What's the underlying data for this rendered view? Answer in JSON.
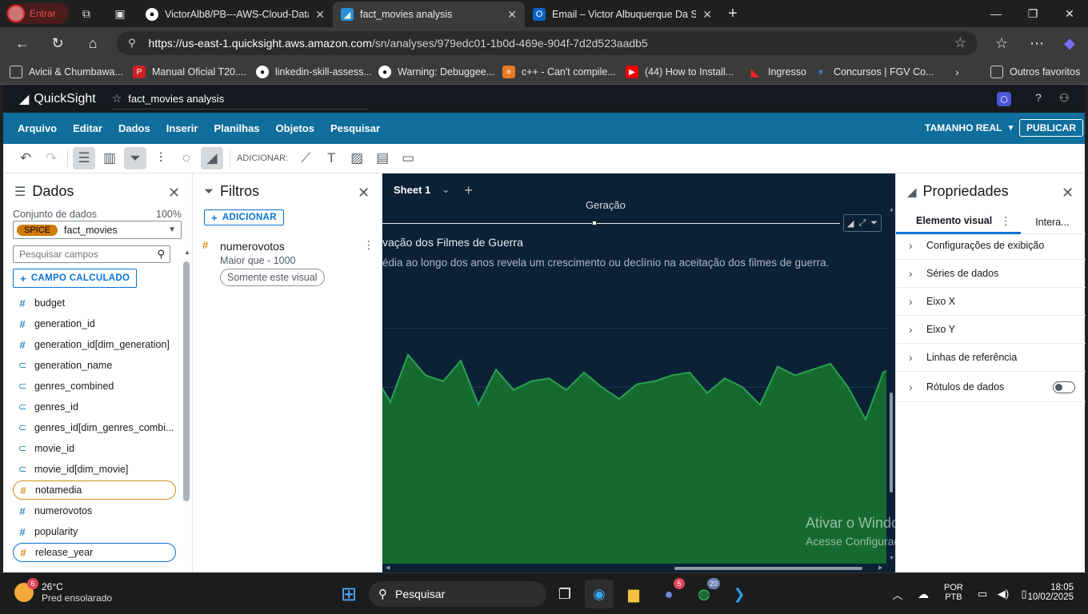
{
  "browser": {
    "profile_label": "Entrar",
    "tabs": [
      {
        "title": "VictorAlb8/PB---AWS-Cloud-Data",
        "icon": "github-icon"
      },
      {
        "title": "fact_movies analysis",
        "icon": "quicksight-icon",
        "active": true
      },
      {
        "title": "Email – Victor Albuquerque Da Si",
        "icon": "outlook-icon"
      }
    ],
    "url_host": "https://us-east-1.quicksight.aws.amazon.com",
    "url_path": "/sn/analyses/979edc01-1b0d-469e-904f-7d2d523aadb5",
    "bookmarks": [
      "Avicii & Chumbawa...",
      "Manual Oficial T20....",
      "linkedin-skill-assess...",
      "Warning: Debuggee...",
      "c++ - Can't compile...",
      "(44) How to Install...",
      "Ingresso",
      "Concursos | FGV Co..."
    ],
    "other_favorites": "Outros favoritos"
  },
  "quicksight": {
    "brand": "QuickSight",
    "analysis_name": "fact_movies analysis",
    "menu": [
      "Arquivo",
      "Editar",
      "Dados",
      "Inserir",
      "Planilhas",
      "Objetos",
      "Pesquisar"
    ],
    "view_size": "TAMANHO REAL",
    "publish": "PUBLICAR",
    "add_label": "ADICIONAR:",
    "colors": {
      "header": "#16191f",
      "menu": "#0f6e9c",
      "canvas": "#0b2136",
      "area": "#166a2f",
      "line": "#2aa152"
    }
  },
  "dados": {
    "title": "Dados",
    "dataset_label": "Conjunto de dados",
    "dataset_pct": "100%",
    "spice": "SPICE",
    "dataset": "fact_movies",
    "search_placeholder": "Pesquisar campos",
    "calc_field": "CAMPO CALCULADO",
    "fields": [
      {
        "name": "budget",
        "type": "num"
      },
      {
        "name": "generation_id",
        "type": "num"
      },
      {
        "name": "generation_id[dim_generation]",
        "type": "num"
      },
      {
        "name": "generation_name",
        "type": "dim"
      },
      {
        "name": "genres_combined",
        "type": "dim"
      },
      {
        "name": "genres_id",
        "type": "dim"
      },
      {
        "name": "genres_id[dim_genres_combi...",
        "type": "dim"
      },
      {
        "name": "movie_id",
        "type": "dim"
      },
      {
        "name": "movie_id[dim_movie]",
        "type": "dim"
      },
      {
        "name": "notamedia",
        "type": "num",
        "selected": "orange"
      },
      {
        "name": "numerovotos",
        "type": "num"
      },
      {
        "name": "popularity",
        "type": "num"
      },
      {
        "name": "release_year",
        "type": "num",
        "selected": "blue"
      }
    ]
  },
  "filtros": {
    "title": "Filtros",
    "add": "ADICIONAR",
    "filter_field": "numerovotos",
    "filter_condition": "Maior que - 1000",
    "filter_scope": "Somente este visual"
  },
  "sheet": {
    "tab": "Sheet 1",
    "top_label": "Geração",
    "visual_title": "vação dos Filmes de Guerra",
    "visual_subtitle": "édia ao longo dos anos revela um crescimento ou declínio na aceitação dos filmes de guerra."
  },
  "chart_data": {
    "type": "area",
    "title": "",
    "xlabel": "",
    "ylabel": "",
    "ylim": [
      0,
      10
    ],
    "grid": true,
    "values": [
      6.5,
      5.5,
      7.1,
      6.4,
      6.2,
      6.9,
      5.4,
      6.6,
      5.9,
      6.2,
      6.3,
      5.9,
      6.5,
      6.0,
      5.6,
      6.1,
      6.2,
      6.4,
      6.5,
      5.8,
      6.3,
      6.0,
      5.4,
      6.7,
      6.4,
      6.6,
      6.8,
      6.0,
      4.9,
      6.5,
      6.8
    ]
  },
  "props": {
    "title": "Propriedades",
    "tab_visual": "Elemento visual",
    "tab_interact": "Intera...",
    "items": [
      "Configurações de exibição",
      "Séries de dados",
      "Eixo X",
      "Eixo Y",
      "Linhas de referência",
      "Rótulos de dados"
    ]
  },
  "watermark": {
    "line1": "Ativar o Windows",
    "line2": "Acesse Configurações para ativar o Windows."
  },
  "taskbar": {
    "weather_temp": "26°C",
    "weather_desc": "Pred ensolarado",
    "weather_badge": "6",
    "search": "Pesquisar",
    "discord_badge": "5",
    "whatsapp_badge": "20",
    "lang1": "POR",
    "lang2": "PTB",
    "time": "18:05",
    "date": "10/02/2025"
  }
}
